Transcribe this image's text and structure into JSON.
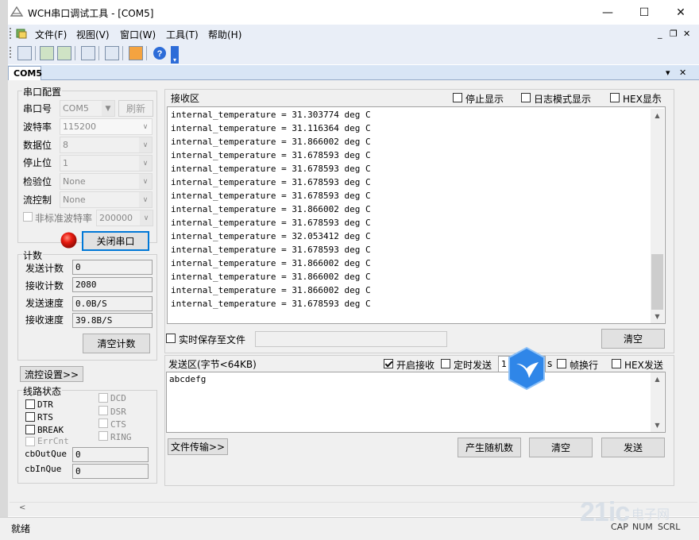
{
  "window": {
    "title": "WCH串口调试工具 - [COM5]",
    "minimize": "—",
    "maximize": "☐",
    "close": "✕"
  },
  "menu": {
    "items": [
      "文件(F)",
      "视图(V)",
      "窗口(W)",
      "工具(T)",
      "帮助(H)"
    ],
    "mdi_min": "_",
    "mdi_restore": "❐",
    "mdi_close": "✕"
  },
  "tab": {
    "label": "COM5",
    "dropdown": "▾",
    "close": "✕"
  },
  "serial_config": {
    "title": "串口配置",
    "port_label": "串口号",
    "port_value": "COM5",
    "refresh": "刷新",
    "baud_label": "波特率",
    "baud_value": "115200",
    "databits_label": "数据位",
    "databits_value": "8",
    "stopbits_label": "停止位",
    "stopbits_value": "1",
    "parity_label": "检验位",
    "parity_value": "None",
    "flow_label": "流控制",
    "flow_value": "None",
    "nonstd_label": "非标准波特率",
    "nonstd_value": "200000",
    "close_port": "关闭串口"
  },
  "counter": {
    "title": "计数",
    "sent_label": "发送计数",
    "sent_value": "0",
    "recv_label": "接收计数",
    "recv_value": "2080",
    "send_speed_label": "发送速度",
    "send_speed_value": "0.0B/S",
    "recv_speed_label": "接收速度",
    "recv_speed_value": "39.8B/S",
    "clear": "清空计数"
  },
  "flow_settings": "流控设置>>",
  "line_status": {
    "title": "线路状态",
    "dtr": "DTR",
    "rts": "RTS",
    "brk": "BREAK",
    "errcnt": "ErrCnt",
    "dcd": "DCD",
    "dsr": "DSR",
    "cts": "CTS",
    "ring": "RING",
    "outque_label": "cbOutQue",
    "outque_value": "0",
    "inque_label": "cbInQue",
    "inque_value": "0"
  },
  "receive": {
    "title": "接收区",
    "stop_display": "停止显示",
    "log_mode": "日志模式显示",
    "hex_display": "HEX显示",
    "lines": [
      "internal_temperature = 31.303774 deg C",
      "internal_temperature = 31.116364 deg C",
      "internal_temperature = 31.866002 deg C",
      "internal_temperature = 31.678593 deg C",
      "internal_temperature = 31.678593 deg C",
      "internal_temperature = 31.678593 deg C",
      "internal_temperature = 31.678593 deg C",
      "internal_temperature = 31.866002 deg C",
      "internal_temperature = 31.678593 deg C",
      "internal_temperature = 32.053412 deg C",
      "internal_temperature = 31.678593 deg C",
      "internal_temperature = 31.866002 deg C",
      "internal_temperature = 31.866002 deg C",
      "internal_temperature = 31.866002 deg C",
      "internal_temperature = 31.678593 deg C"
    ],
    "save_to_file": "实时保存至文件",
    "file_path": "",
    "clear": "清空"
  },
  "send": {
    "title": "发送区(字节<64KB)",
    "enable_receive": "开启接收",
    "timed_send": "定时发送",
    "interval_value": "1",
    "interval_unit": "s",
    "frame_newline": "帧换行",
    "hex_send": "HEX发送",
    "content": "abcdefg",
    "file_transfer": "文件传输>>",
    "random": "产生随机数",
    "clear": "清空",
    "send": "发送"
  },
  "status": {
    "text": "就绪",
    "caps": "CAP",
    "num": "NUM",
    "scrl": "SCRL"
  },
  "watermark": {
    "text": "电子网"
  },
  "colors": {
    "accent": "#0078d7",
    "led": "#e81b10",
    "badge": "#2f86e8"
  },
  "icons": {
    "led": "red-status-led-icon",
    "badge": "blue-bird-badge-icon"
  }
}
